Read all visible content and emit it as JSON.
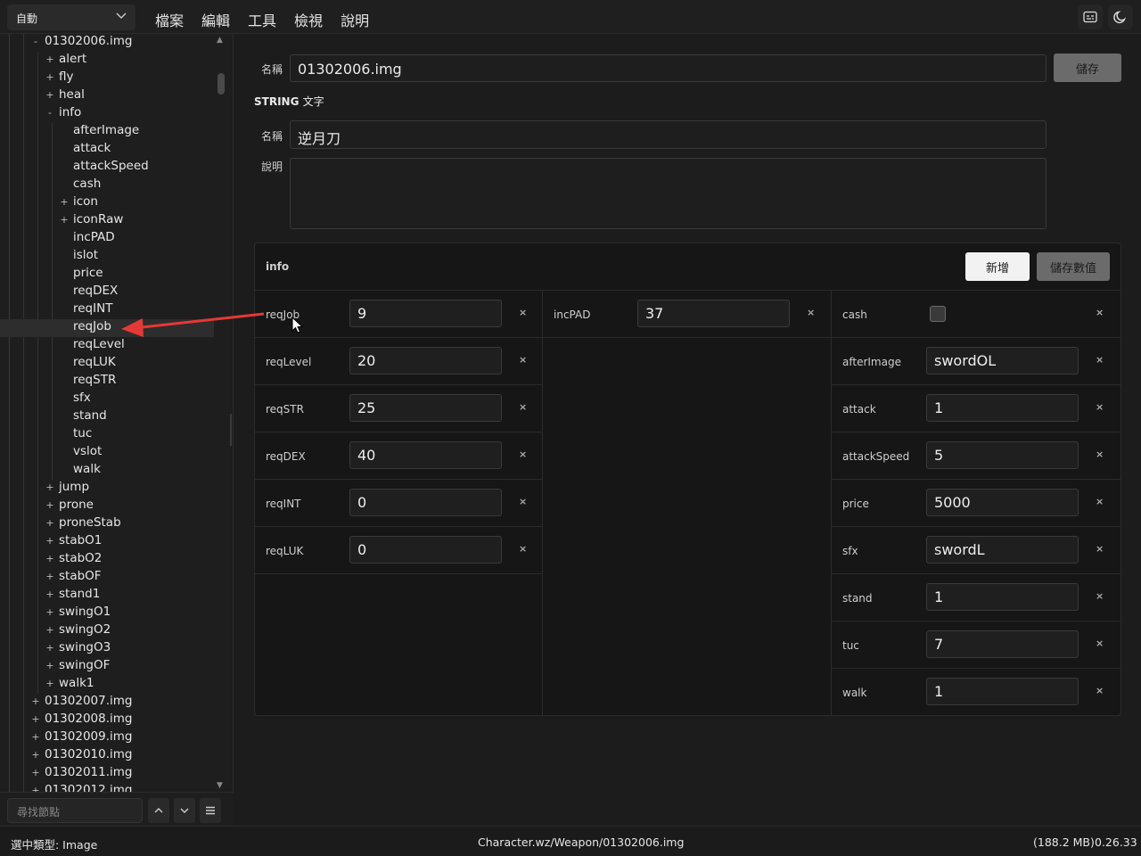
{
  "topbar": {
    "mode_select": "自動",
    "menu": [
      "檔案",
      "編輯",
      "工具",
      "檢視",
      "說明"
    ]
  },
  "tree": {
    "nodes": [
      {
        "label": "01302006.img",
        "toggle": "-"
      },
      {
        "label": "alert",
        "toggle": "+"
      },
      {
        "label": "fly",
        "toggle": "+"
      },
      {
        "label": "heal",
        "toggle": "+"
      },
      {
        "label": "info",
        "toggle": "-"
      },
      {
        "label": "afterImage",
        "toggle": ""
      },
      {
        "label": "attack",
        "toggle": ""
      },
      {
        "label": "attackSpeed",
        "toggle": ""
      },
      {
        "label": "cash",
        "toggle": ""
      },
      {
        "label": "icon",
        "toggle": "+"
      },
      {
        "label": "iconRaw",
        "toggle": "+"
      },
      {
        "label": "incPAD",
        "toggle": ""
      },
      {
        "label": "islot",
        "toggle": ""
      },
      {
        "label": "price",
        "toggle": ""
      },
      {
        "label": "reqDEX",
        "toggle": ""
      },
      {
        "label": "reqINT",
        "toggle": ""
      },
      {
        "label": "reqJob",
        "toggle": ""
      },
      {
        "label": "reqLevel",
        "toggle": ""
      },
      {
        "label": "reqLUK",
        "toggle": ""
      },
      {
        "label": "reqSTR",
        "toggle": ""
      },
      {
        "label": "sfx",
        "toggle": ""
      },
      {
        "label": "stand",
        "toggle": ""
      },
      {
        "label": "tuc",
        "toggle": ""
      },
      {
        "label": "vslot",
        "toggle": ""
      },
      {
        "label": "walk",
        "toggle": ""
      },
      {
        "label": "jump",
        "toggle": "+"
      },
      {
        "label": "prone",
        "toggle": "+"
      },
      {
        "label": "proneStab",
        "toggle": "+"
      },
      {
        "label": "stabO1",
        "toggle": "+"
      },
      {
        "label": "stabO2",
        "toggle": "+"
      },
      {
        "label": "stabOF",
        "toggle": "+"
      },
      {
        "label": "stand1",
        "toggle": "+"
      },
      {
        "label": "swingO1",
        "toggle": "+"
      },
      {
        "label": "swingO2",
        "toggle": "+"
      },
      {
        "label": "swingO3",
        "toggle": "+"
      },
      {
        "label": "swingOF",
        "toggle": "+"
      },
      {
        "label": "walk1",
        "toggle": "+"
      },
      {
        "label": "01302007.img",
        "toggle": "+"
      },
      {
        "label": "01302008.img",
        "toggle": "+"
      },
      {
        "label": "01302009.img",
        "toggle": "+"
      },
      {
        "label": "01302010.img",
        "toggle": "+"
      },
      {
        "label": "01302011.img",
        "toggle": "+"
      },
      {
        "label": "01302012.img",
        "toggle": "+"
      }
    ],
    "search_placeholder": "尋找節點"
  },
  "editor": {
    "name_label": "名稱",
    "name_value": "01302006.img",
    "save_label": "儲存",
    "string_title": "STRING",
    "string_sub": "文字",
    "string_name_label": "名稱",
    "string_name_value": "逆月刀",
    "desc_label": "說明",
    "desc_value": ""
  },
  "info_panel": {
    "title": "info",
    "add_label": "新增",
    "save_values_label": "儲存數值",
    "col1": [
      {
        "key": "reqJob",
        "value": "9"
      },
      {
        "key": "reqLevel",
        "value": "20"
      },
      {
        "key": "reqSTR",
        "value": "25"
      },
      {
        "key": "reqDEX",
        "value": "40"
      },
      {
        "key": "reqINT",
        "value": "0"
      },
      {
        "key": "reqLUK",
        "value": "0"
      }
    ],
    "col2": [
      {
        "key": "incPAD",
        "value": "37"
      }
    ],
    "col3": [
      {
        "key": "cash",
        "value": ""
      },
      {
        "key": "afterImage",
        "value": "swordOL"
      },
      {
        "key": "attack",
        "value": "1"
      },
      {
        "key": "attackSpeed",
        "value": "5"
      },
      {
        "key": "price",
        "value": "5000"
      },
      {
        "key": "sfx",
        "value": "swordL"
      },
      {
        "key": "stand",
        "value": "1"
      },
      {
        "key": "tuc",
        "value": "7"
      },
      {
        "key": "walk",
        "value": "1"
      }
    ],
    "delete_glyph": "×"
  },
  "status": {
    "type": "選中類型: Image",
    "path": "Character.wz/Weapon/01302006.img",
    "memory": "(188.2 MB)",
    "version": "0.26.33"
  },
  "colors": {
    "accent_arrow": "#e53935",
    "panel_bg": "#161616"
  }
}
